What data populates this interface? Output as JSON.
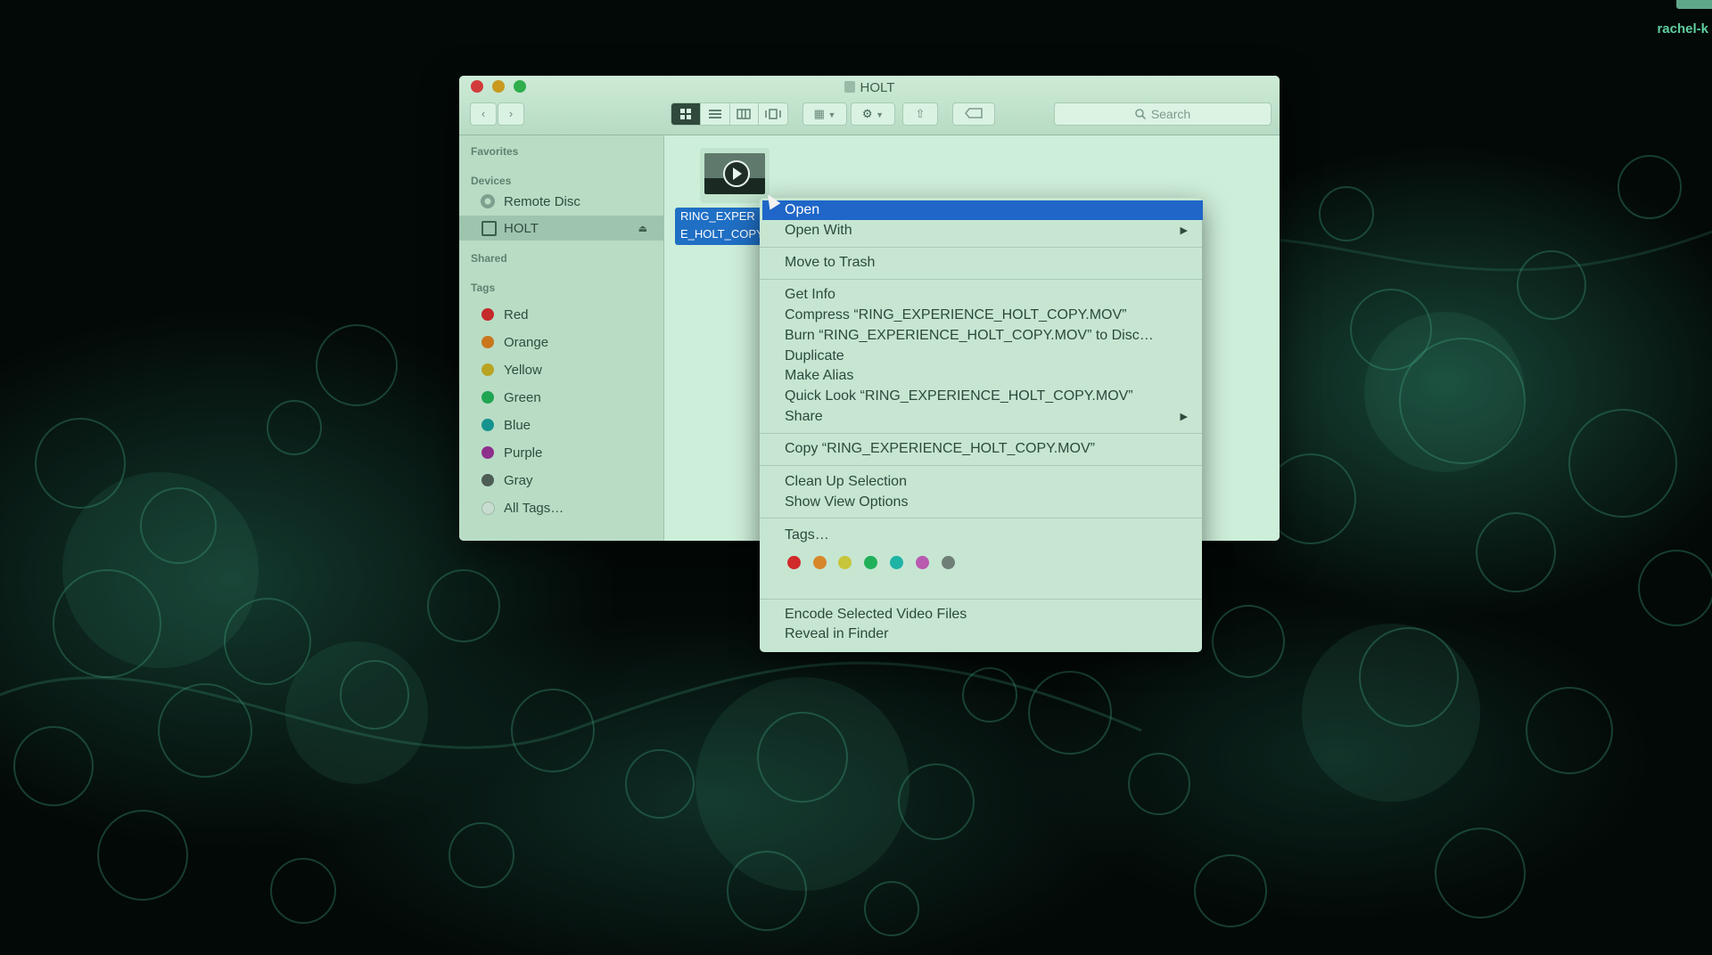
{
  "desktop": {
    "user_label": "rachel-k"
  },
  "window": {
    "title": "HOLT",
    "search_placeholder": "Search"
  },
  "sidebar": {
    "favorites_header": "Favorites",
    "devices_header": "Devices",
    "devices": [
      {
        "label": "Remote Disc"
      },
      {
        "label": "HOLT",
        "selected": true
      }
    ],
    "shared_header": "Shared",
    "tags_header": "Tags",
    "tags": [
      {
        "label": "Red",
        "color": "#c42a2a"
      },
      {
        "label": "Orange",
        "color": "#c9761c"
      },
      {
        "label": "Yellow",
        "color": "#b9a321"
      },
      {
        "label": "Green",
        "color": "#1fa552"
      },
      {
        "label": "Blue",
        "color": "#15938f"
      },
      {
        "label": "Purple",
        "color": "#8f2f8c"
      },
      {
        "label": "Gray",
        "color": "#4d5d55"
      },
      {
        "label": "All Tags…",
        "color": ""
      }
    ]
  },
  "file": {
    "name_line1": "RING_EXPER",
    "name_line2": "E_HOLT_COPY"
  },
  "context_menu": {
    "items": {
      "open": "Open",
      "open_with": "Open With",
      "move_to_trash": "Move to Trash",
      "get_info": "Get Info",
      "compress": "Compress “RING_EXPERIENCE_HOLT_COPY.MOV”",
      "burn": "Burn “RING_EXPERIENCE_HOLT_COPY.MOV” to Disc…",
      "duplicate": "Duplicate",
      "make_alias": "Make Alias",
      "quick_look": "Quick Look “RING_EXPERIENCE_HOLT_COPY.MOV”",
      "share": "Share",
      "copy": "Copy “RING_EXPERIENCE_HOLT_COPY.MOV”",
      "clean_up": "Clean Up Selection",
      "show_view_options": "Show View Options",
      "tags": "Tags…",
      "encode": "Encode Selected Video Files",
      "reveal": "Reveal in Finder"
    },
    "tag_colors": [
      "#d02a2a",
      "#d8862a",
      "#c8c53a",
      "#20b05a",
      "#1db3a5",
      "#b85ab0",
      "#6f7f77"
    ]
  }
}
